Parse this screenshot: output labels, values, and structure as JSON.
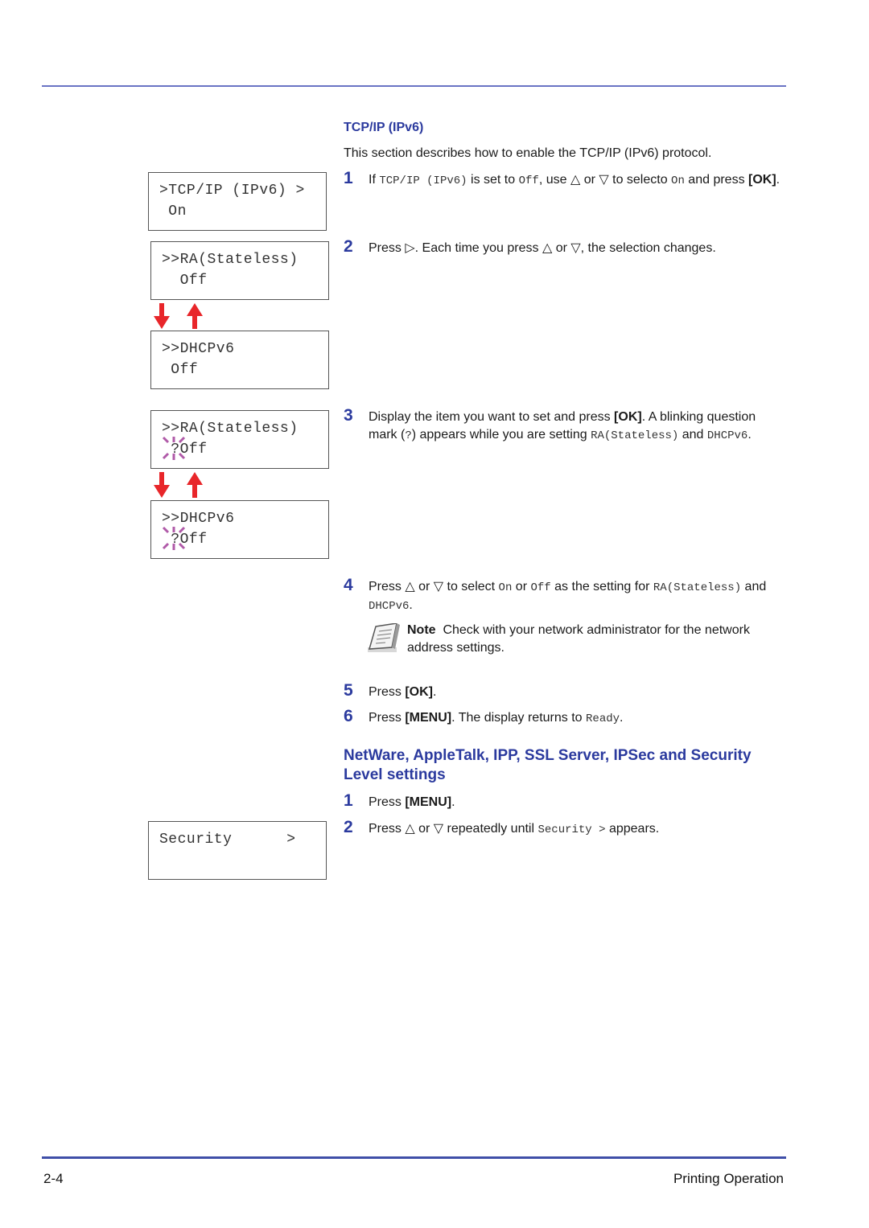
{
  "colors": {
    "heading_blue": "#2b3a9e",
    "rule_blue": "#6a74c4",
    "arrow_red": "#e8262a",
    "blink_magenta": "#b05aa8"
  },
  "lcd_panels": [
    {
      "line1": ">TCP/IP (IPv6) >",
      "line2": " On"
    },
    {
      "line1": ">>RA(Stateless)",
      "line2": "  Off"
    },
    {
      "line1": ">>DHCPv6",
      "line2": " Off"
    },
    {
      "line1": ">>RA(Stateless)",
      "line2": " ?Off"
    },
    {
      "line1": ">>DHCPv6",
      "line2": " ?Off"
    },
    {
      "line1": "Security      >",
      "line2": ""
    }
  ],
  "icons": {
    "arrow_down": "down-arrow",
    "arrow_up": "up-arrow",
    "blink": "blinking-cursor",
    "note": "note-paper"
  },
  "section1": {
    "heading": "TCP/IP (IPv6)",
    "intro": "This section describes how to enable the TCP/IP (IPv6) protocol.",
    "steps": [
      {
        "num": "1",
        "parts": [
          "If ",
          "TCP/IP (IPv6)",
          " is set to ",
          "Off",
          ", use △ or ▽ to selecto ",
          "On",
          " and press ",
          "[OK]",
          "."
        ]
      },
      {
        "num": "2",
        "text": "Press ▷. Each time you press △ or ▽, the selection changes."
      },
      {
        "num": "3",
        "parts": [
          "Display the item you want to set and press ",
          "[OK]",
          ". A blinking question mark (",
          "?",
          ") appears while you are setting ",
          "RA(Stateless)",
          " and ",
          "DHCPv6",
          "."
        ]
      },
      {
        "num": "4",
        "parts": [
          "Press △ or ▽ to select ",
          "On",
          " or ",
          "Off",
          " as the setting for ",
          "RA(Stateless)",
          " and ",
          "DHCPv6",
          "."
        ]
      },
      {
        "num": "5",
        "parts": [
          "Press ",
          "[OK]",
          "."
        ]
      },
      {
        "num": "6",
        "parts": [
          "Press ",
          "[MENU]",
          ". The display returns to ",
          "Ready",
          "."
        ]
      }
    ],
    "note": {
      "label": "Note",
      "text": "Check with your network administrator for the network address settings."
    }
  },
  "section2": {
    "heading": "NetWare, AppleTalk, IPP, SSL Server, IPSec and Security Level settings",
    "steps": [
      {
        "num": "1",
        "parts": [
          "Press ",
          "[MENU]",
          "."
        ]
      },
      {
        "num": "2",
        "parts": [
          "Press △ or ▽ repeatedly until ",
          "Security >",
          " appears."
        ]
      }
    ]
  },
  "footer": {
    "page_number": "2-4",
    "chapter": "Printing Operation"
  }
}
